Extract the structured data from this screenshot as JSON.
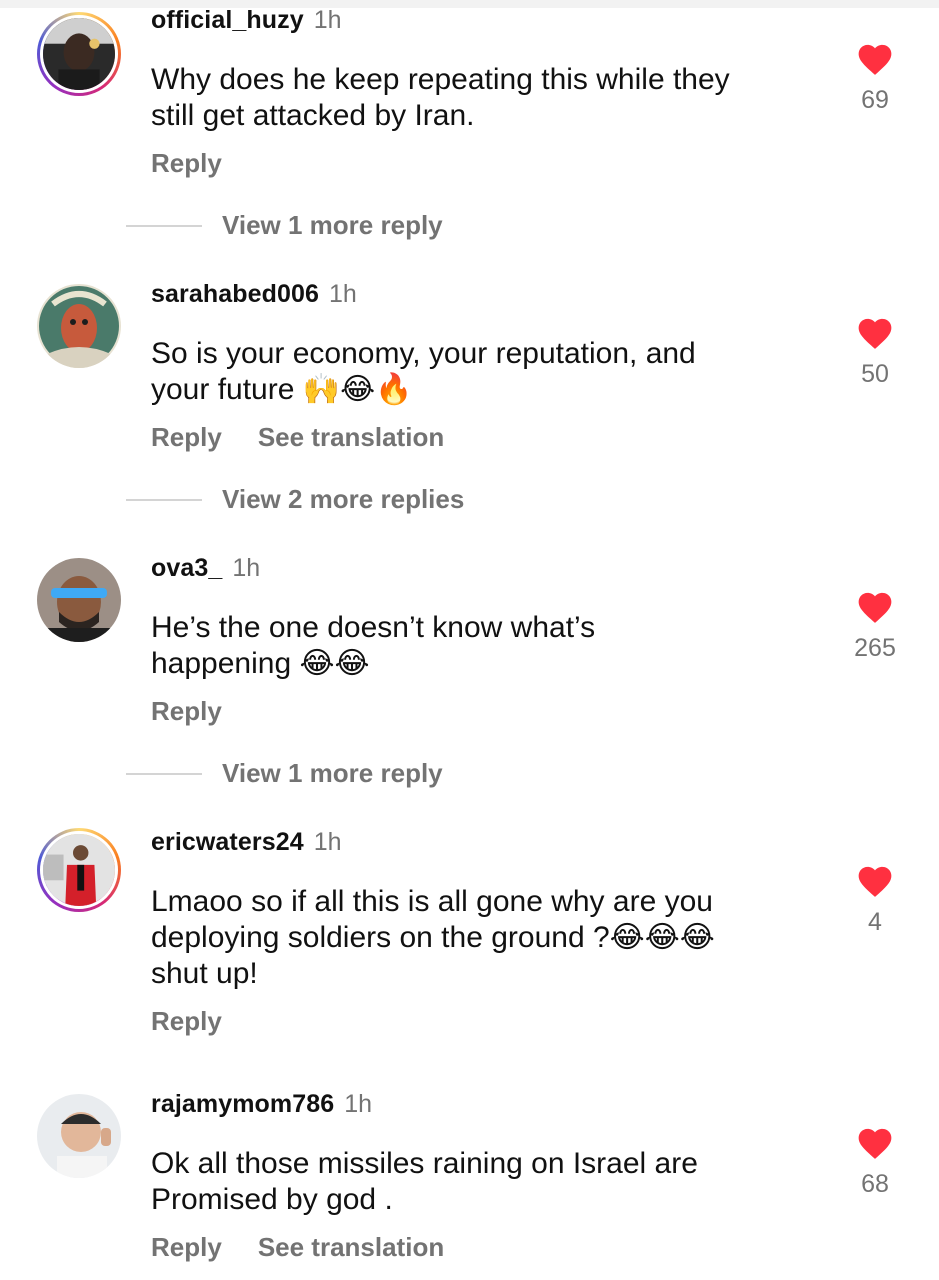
{
  "comments": [
    {
      "username": "official_huzy",
      "time": "1h",
      "text_lines": [
        "Why does he keep repeating this while they",
        "still get attacked by Iran."
      ],
      "likes": "69",
      "actions": [
        "Reply"
      ],
      "view_more": "View 1 more reply"
    },
    {
      "username": "sarahabed006",
      "time": "1h",
      "text_lines": [
        "So is your economy, your reputation, and",
        "your future 🙌😂🔥"
      ],
      "likes": "50",
      "actions": [
        "Reply",
        "See translation"
      ],
      "view_more": "View 2 more replies"
    },
    {
      "username": "ova3_",
      "time": "1h",
      "text_lines": [
        "He’s the one doesn’t know what’s",
        "happening 😂😂"
      ],
      "likes": "265",
      "actions": [
        "Reply"
      ],
      "view_more": "View 1 more reply"
    },
    {
      "username": "ericwaters24",
      "time": "1h",
      "text_lines": [
        "Lmaoo so if all this is all gone why are you",
        "deploying soldiers on the ground ?😂😂😂",
        "shut up!"
      ],
      "likes": "4",
      "actions": [
        "Reply"
      ]
    },
    {
      "username": "rajamymom786",
      "time": "1h",
      "text_lines": [
        "Ok all those missiles raining on Israel  are",
        "Promised by god ."
      ],
      "likes": "68",
      "actions": [
        "Reply",
        "See translation"
      ]
    }
  ],
  "icons": {
    "like": "heart-icon",
    "avatar": "avatar"
  },
  "colors": {
    "heart": "#ff3040",
    "secondary_text": "#737373",
    "primary_text": "#111111"
  }
}
